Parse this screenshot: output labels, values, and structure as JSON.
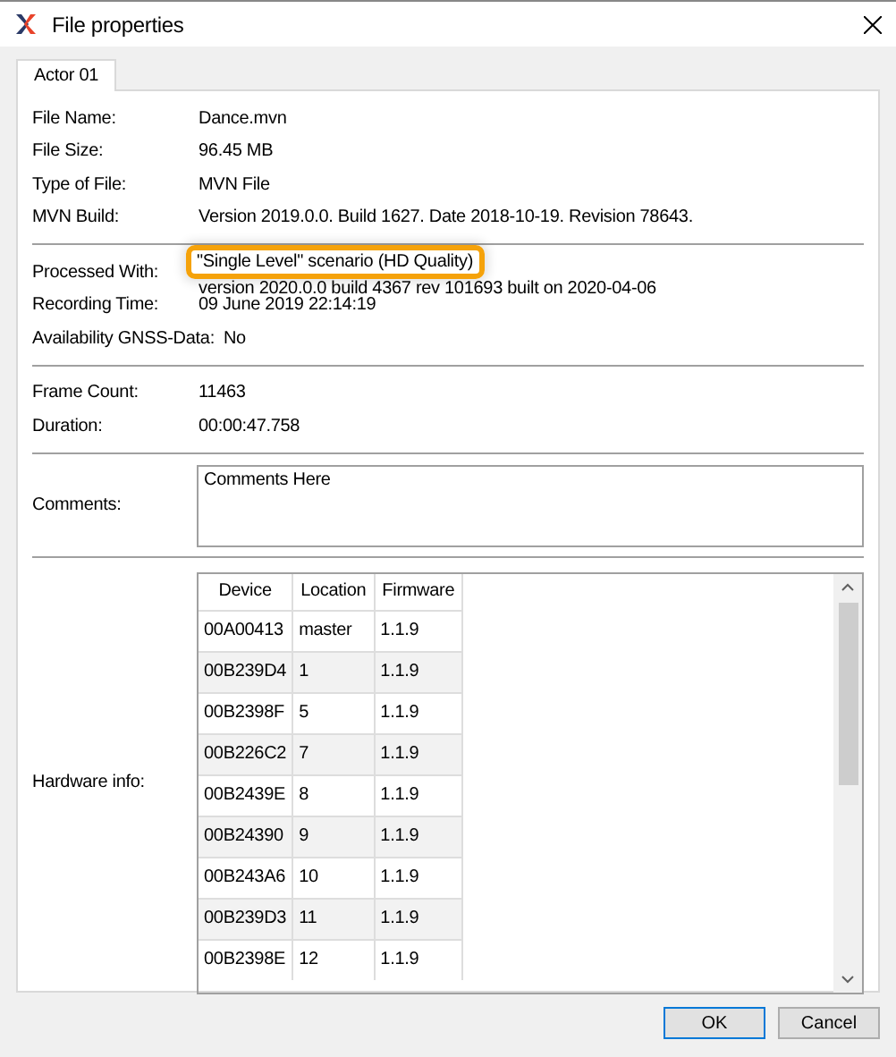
{
  "window": {
    "title": "File properties"
  },
  "tabs": [
    {
      "label": "Actor 01",
      "selected": true
    }
  ],
  "sections": [
    {
      "fields": [
        {
          "label": "File Name:",
          "value": [
            {
              "text": "Dance.mvn",
              "highlighted": false
            }
          ]
        },
        {
          "label": "File Size:",
          "value": [
            {
              "text": "96.45 MB",
              "highlighted": false
            }
          ]
        },
        {
          "label": "Type of File:",
          "value": [
            {
              "text": "MVN File",
              "highlighted": false
            }
          ]
        },
        {
          "label": "MVN Build:",
          "value": [
            {
              "text": "Version 2019.0.0. Build 1627. Date 2018-10-19. Revision 78643.",
              "highlighted": false
            }
          ]
        }
      ]
    },
    {
      "fields": [
        {
          "label": "Processed With:",
          "value": [
            {
              "text": "\"Single Level\" scenario (HD Quality)",
              "highlighted": true
            },
            {
              "text": "version 2020.0.0 build 4367 rev 101693 built on 2020-04-06",
              "highlighted": false
            }
          ]
        },
        {
          "label": "Recording Time:",
          "value": [
            {
              "text": "09 June 2019 22:14:19",
              "highlighted": false
            }
          ]
        },
        {
          "label": "Availability GNSS-Data:",
          "value": [
            {
              "text": "No",
              "highlighted": false
            }
          ]
        }
      ]
    },
    {
      "fields": [
        {
          "label": "Frame Count:",
          "value": [
            {
              "text": "11463",
              "highlighted": false
            }
          ]
        },
        {
          "label": "Duration:",
          "value": [
            {
              "text": "00:00:47.758",
              "highlighted": false
            }
          ]
        }
      ]
    }
  ],
  "comments": {
    "label": "Comments:",
    "value": "Comments Here"
  },
  "hardware": {
    "label": "Hardware info:",
    "columns": [
      "Device",
      "Location",
      "Firmware"
    ],
    "rows": [
      [
        "00A00413",
        "master",
        "1.1.9"
      ],
      [
        "00B239D4",
        "1",
        "1.1.9"
      ],
      [
        "00B2398F",
        "5",
        "1.1.9"
      ],
      [
        "00B226C2",
        "7",
        "1.1.9"
      ],
      [
        "00B2439E",
        "8",
        "1.1.9"
      ],
      [
        "00B24390",
        "9",
        "1.1.9"
      ],
      [
        "00B243A6",
        "10",
        "1.1.9"
      ],
      [
        "00B239D3",
        "11",
        "1.1.9"
      ],
      [
        "00B2398E",
        "12",
        "1.1.9"
      ]
    ]
  },
  "buttons": [
    {
      "label": "OK",
      "default": true
    },
    {
      "label": "Cancel",
      "default": false
    }
  ]
}
